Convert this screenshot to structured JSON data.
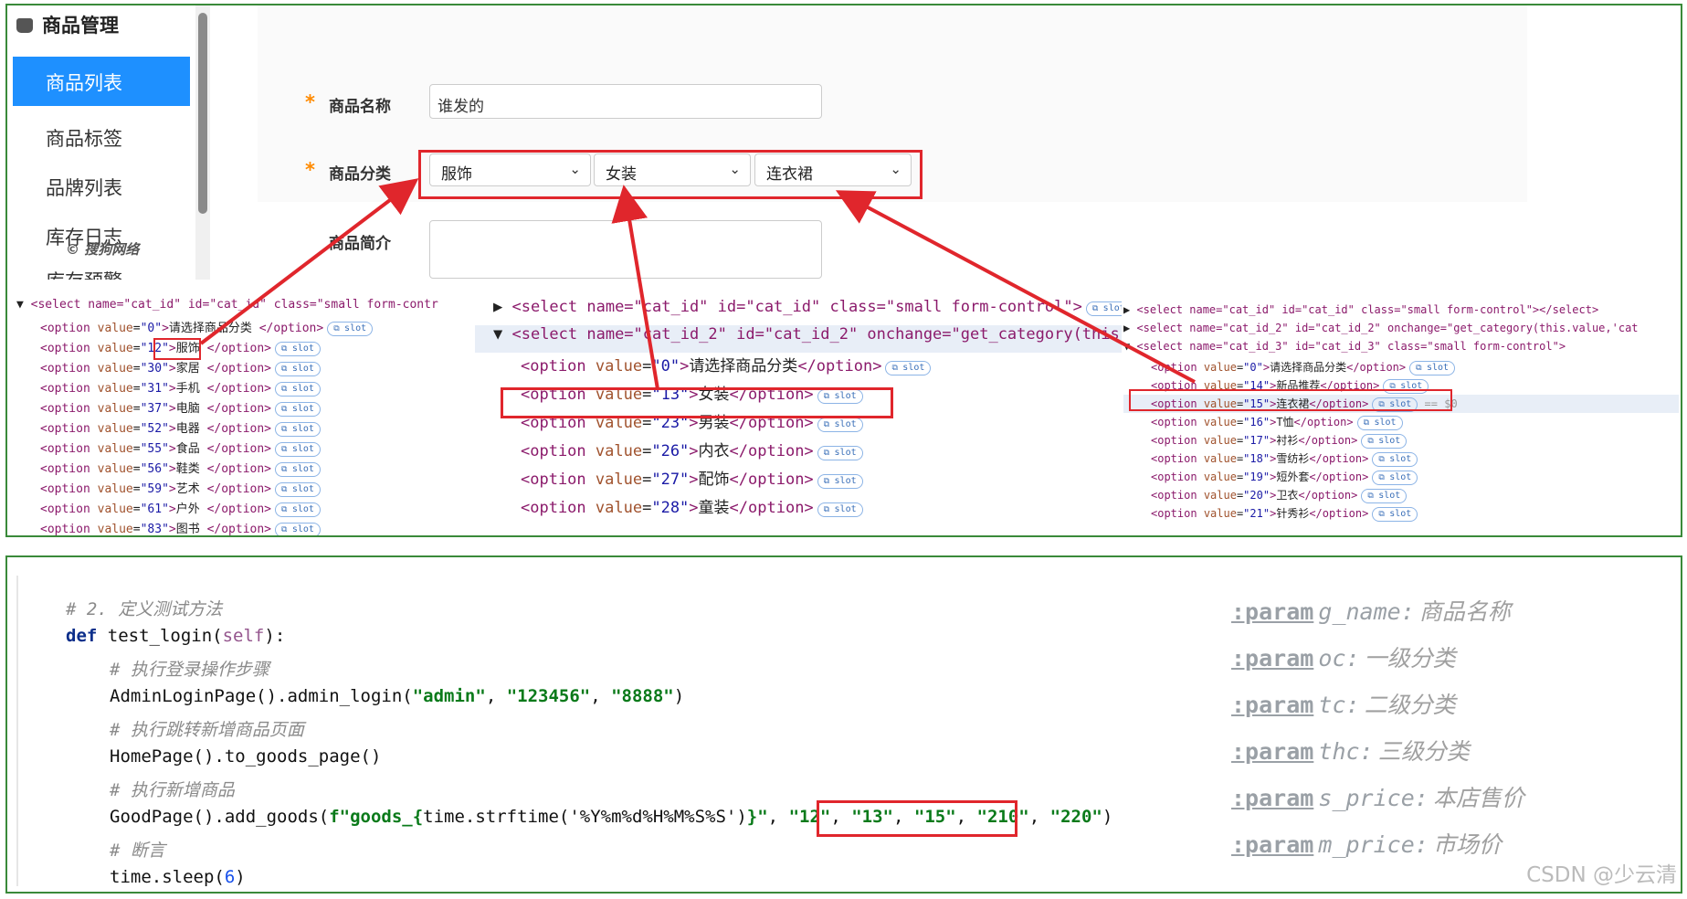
{
  "sidebar": {
    "title": "商品管理",
    "items": [
      "商品列表",
      "商品标签",
      "品牌列表",
      "库存日志",
      "库存预警"
    ],
    "watermark": "© 搜狗网络"
  },
  "form": {
    "name_label": "商品名称",
    "name_value": "谁发的",
    "category_label": "商品分类",
    "category_values": [
      "服饰",
      "女装",
      "连衣裙"
    ],
    "intro_label": "商品简介",
    "required_mark": "*"
  },
  "dev_panel_1": {
    "select_line": "<select name=\"cat_id\" id=\"cat_id\" class=\"small form-contr",
    "options": [
      {
        "value": "0",
        "text": "请选择商品分类"
      },
      {
        "value": "12",
        "text": "服饰"
      },
      {
        "value": "30",
        "text": "家居"
      },
      {
        "value": "31",
        "text": "手机"
      },
      {
        "value": "37",
        "text": "电脑"
      },
      {
        "value": "52",
        "text": "电器"
      },
      {
        "value": "55",
        "text": "食品"
      },
      {
        "value": "56",
        "text": "鞋类"
      },
      {
        "value": "59",
        "text": "艺术"
      },
      {
        "value": "61",
        "text": "户外"
      },
      {
        "value": "83",
        "text": "图书"
      }
    ]
  },
  "dev_panel_2": {
    "select_line_1": "<select name=\"cat_id\" id=\"cat_id\" class=\"small form-control\">",
    "select_line_2": "<select name=\"cat_id_2\" id=\"cat_id_2\" onchange=\"get_category(this.va",
    "options": [
      {
        "value": "0",
        "text": "请选择商品分类"
      },
      {
        "value": "13",
        "text": "女装"
      },
      {
        "value": "23",
        "text": "男装"
      },
      {
        "value": "26",
        "text": "内衣"
      },
      {
        "value": "27",
        "text": "配饰"
      },
      {
        "value": "28",
        "text": "童装"
      }
    ]
  },
  "dev_panel_3": {
    "select_line_1": "<select name=\"cat_id\" id=\"cat_id\" class=\"small form-control\">",
    "select_line_1_end": "</select>",
    "select_line_2": "<select name=\"cat_id_2\" id=\"cat_id_2\" onchange=\"get_category(this.value,'cat",
    "select_line_3": "<select name=\"cat_id_3\" id=\"cat_id_3\" class=\"small form-control\">",
    "options": [
      {
        "value": "0",
        "text": "请选择商品分类"
      },
      {
        "value": "14",
        "text": "新品推荐"
      },
      {
        "value": "15",
        "text": "连衣裙"
      },
      {
        "value": "16",
        "text": "T恤"
      },
      {
        "value": "17",
        "text": "衬衫"
      },
      {
        "value": "18",
        "text": "雪纺衫"
      },
      {
        "value": "19",
        "text": "短外套"
      },
      {
        "value": "20",
        "text": "卫衣"
      },
      {
        "value": "21",
        "text": "针秀衫"
      }
    ],
    "selected_marker": "== $0"
  },
  "slot_label": "slot",
  "code": {
    "comment_1": "# 2. 定义测试方法",
    "def_kw": "def",
    "func": " test_login(",
    "self": "self",
    "func_end": "):",
    "comment_2": "# 执行登录操作步骤",
    "login_call": "AdminLoginPage().admin_login(",
    "login_args": [
      "\"admin\"",
      "\"123456\"",
      "\"8888\""
    ],
    "comment_3": "# 执行跳转新增商品页面",
    "home_call": "HomePage().to_goods_page()",
    "comment_4": "# 执行新增商品",
    "goods_call": "GoodPage().add_goods(",
    "fstring": "f\"goods_{",
    "fstring_mid": "time.strftime('%Y%m%d%H%M%S%S')",
    "fstring_end": "}\"",
    "cat_args": [
      "\"12\"",
      "\"13\"",
      "\"15\""
    ],
    "price_args": [
      "\"210\"",
      "\"220\""
    ],
    "comment_5": "# 断言",
    "sleep_call": "time.sleep(",
    "sleep_val": "6",
    "sleep_end": ")"
  },
  "params": [
    {
      "key": ":param",
      "name": "g_name:",
      "desc": "商品名称"
    },
    {
      "key": ":param",
      "name": "oc:",
      "desc": "一级分类"
    },
    {
      "key": ":param",
      "name": "tc:",
      "desc": "二级分类"
    },
    {
      "key": ":param",
      "name": "thc:",
      "desc": "三级分类"
    },
    {
      "key": ":param",
      "name": "s_price:",
      "desc": "本店售价"
    },
    {
      "key": ":param",
      "name": "m_price:",
      "desc": "市场价"
    }
  ],
  "watermark": "CSDN @少云清",
  "colors": {
    "accent": "#1e90ff",
    "highlight": "#e0262c",
    "frame": "#3a8a3a"
  }
}
